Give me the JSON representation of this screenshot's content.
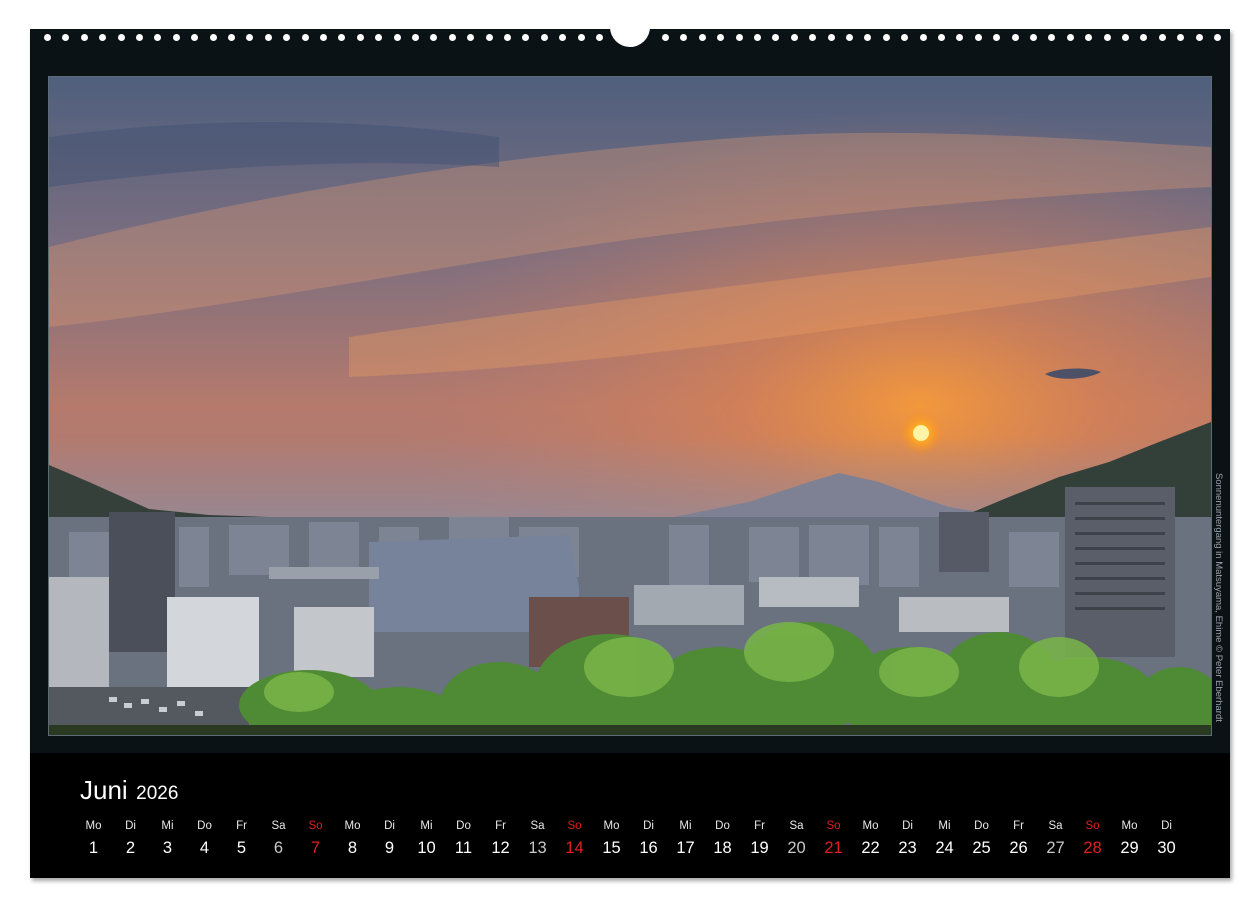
{
  "calendar": {
    "month_name": "Juni",
    "year": "2026",
    "photo_credit": "Sonnenuntergang in Matsuyama, Ehime © Peter Eberhardt",
    "days": [
      {
        "weekday": "Mo",
        "date": "1",
        "type": "weekday"
      },
      {
        "weekday": "Di",
        "date": "2",
        "type": "weekday"
      },
      {
        "weekday": "Mi",
        "date": "3",
        "type": "weekday"
      },
      {
        "weekday": "Do",
        "date": "4",
        "type": "weekday"
      },
      {
        "weekday": "Fr",
        "date": "5",
        "type": "weekday"
      },
      {
        "weekday": "Sa",
        "date": "6",
        "type": "sat"
      },
      {
        "weekday": "So",
        "date": "7",
        "type": "sun"
      },
      {
        "weekday": "Mo",
        "date": "8",
        "type": "weekday"
      },
      {
        "weekday": "Di",
        "date": "9",
        "type": "weekday"
      },
      {
        "weekday": "Mi",
        "date": "10",
        "type": "weekday"
      },
      {
        "weekday": "Do",
        "date": "11",
        "type": "weekday"
      },
      {
        "weekday": "Fr",
        "date": "12",
        "type": "weekday"
      },
      {
        "weekday": "Sa",
        "date": "13",
        "type": "sat"
      },
      {
        "weekday": "So",
        "date": "14",
        "type": "sun"
      },
      {
        "weekday": "Mo",
        "date": "15",
        "type": "weekday"
      },
      {
        "weekday": "Di",
        "date": "16",
        "type": "weekday"
      },
      {
        "weekday": "Mi",
        "date": "17",
        "type": "weekday"
      },
      {
        "weekday": "Do",
        "date": "18",
        "type": "weekday"
      },
      {
        "weekday": "Fr",
        "date": "19",
        "type": "weekday"
      },
      {
        "weekday": "Sa",
        "date": "20",
        "type": "sat"
      },
      {
        "weekday": "So",
        "date": "21",
        "type": "sun"
      },
      {
        "weekday": "Mo",
        "date": "22",
        "type": "weekday"
      },
      {
        "weekday": "Di",
        "date": "23",
        "type": "weekday"
      },
      {
        "weekday": "Mi",
        "date": "24",
        "type": "weekday"
      },
      {
        "weekday": "Do",
        "date": "25",
        "type": "weekday"
      },
      {
        "weekday": "Fr",
        "date": "26",
        "type": "weekday"
      },
      {
        "weekday": "Sa",
        "date": "27",
        "type": "sat"
      },
      {
        "weekday": "So",
        "date": "28",
        "type": "sun"
      },
      {
        "weekday": "Mo",
        "date": "29",
        "type": "weekday"
      },
      {
        "weekday": "Di",
        "date": "30",
        "type": "weekday"
      }
    ]
  },
  "colors": {
    "page_background": "#ffffff",
    "calendar_background": "#0b1215",
    "date_strip_background": "#000000",
    "sunday_color": "#e0201d",
    "text_color": "#ffffff"
  }
}
